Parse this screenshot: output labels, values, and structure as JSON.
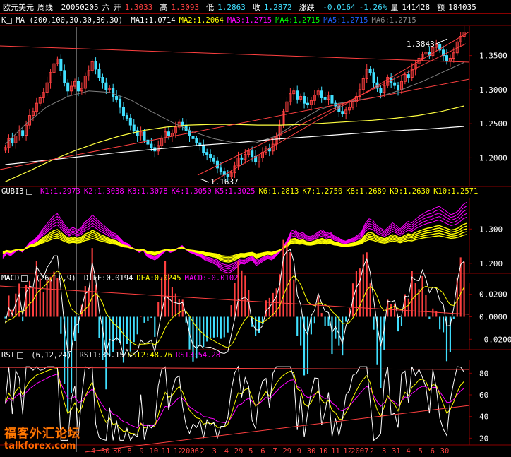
{
  "header": {
    "symbol": "欧元美元",
    "period": "周线",
    "date": "20050205",
    "weekday": "六",
    "open_label": "开",
    "open": "1.3033",
    "high_label": "高",
    "high": "1.3093",
    "low_label": "低",
    "low": "1.2863",
    "close_label": "收",
    "close": "1.2872",
    "change_label": "涨跌",
    "change": "-0.0164",
    "change_pct": "-1.26%",
    "volume_label": "量",
    "volume": "141428",
    "amount_label": "额",
    "amount": "184035"
  },
  "panels": {
    "ma": {
      "label": "K",
      "name": "MA",
      "params": "(200,100,30,30,30,30)",
      "items": [
        {
          "text": "MA1:1.0714",
          "color": "#ffffff"
        },
        {
          "text": "MA2:1.2064",
          "color": "#ffff00"
        },
        {
          "text": "MA3:1.2715",
          "color": "#ff00ff"
        },
        {
          "text": "MA4:1.2715",
          "color": "#00ff00"
        },
        {
          "text": "MA5:1.2715",
          "color": "#2060ff"
        },
        {
          "text": "MA6:1.2715",
          "color": "#888888"
        }
      ]
    },
    "gubi": {
      "name": "GUBI3",
      "items": [
        {
          "text": "K1:1.2973",
          "color": "#ff00ff"
        },
        {
          "text": "K2:1.3038",
          "color": "#ff00ff"
        },
        {
          "text": "K3:1.3078",
          "color": "#ff00ff"
        },
        {
          "text": "K4:1.3050",
          "color": "#ff00ff"
        },
        {
          "text": "K5:1.3025",
          "color": "#ff00ff"
        },
        {
          "text": "K6:1.2813",
          "color": "#ffff00"
        },
        {
          "text": "K7:1.2750",
          "color": "#ffff00"
        },
        {
          "text": "K8:1.2689",
          "color": "#ffff00"
        },
        {
          "text": "K9:1.2630",
          "color": "#ffff00"
        },
        {
          "text": "K10:1.2571",
          "color": "#ffff00"
        }
      ]
    },
    "macd": {
      "name": "MACD",
      "params": "(26,12,9)",
      "items": [
        {
          "text": "DIFF:0.0194",
          "color": "#ffffff"
        },
        {
          "text": "DEA:0.0245",
          "color": "#ffff00"
        },
        {
          "text": "MACD:-0.0102",
          "color": "#ff00ff"
        }
      ]
    },
    "rsi": {
      "name": "RSI",
      "params": "(6,12,24)",
      "items": [
        {
          "text": "RSI1:35.15",
          "color": "#ffffff"
        },
        {
          "text": "RSI2:48.76",
          "color": "#ffff00"
        },
        {
          "text": "RSI3:54.28",
          "color": "#ff00ff"
        }
      ]
    }
  },
  "chart_data": [
    {
      "type": "candlestick",
      "title": "欧元美元 周线",
      "yticks": [
        "1.2000",
        "1.2500",
        "1.3000",
        "1.3500"
      ],
      "ylim": [
        1.16,
        1.39
      ],
      "annotations": [
        "1.3843",
        "1.1637"
      ],
      "close_series": [
        1.215,
        1.228,
        1.222,
        1.232,
        1.24,
        1.233,
        1.248,
        1.262,
        1.268,
        1.28,
        1.288,
        1.296,
        1.31,
        1.325,
        1.338,
        1.345,
        1.328,
        1.31,
        1.298,
        1.305,
        1.312,
        1.298,
        1.302,
        1.32,
        1.328,
        1.341,
        1.33,
        1.318,
        1.31,
        1.3,
        1.302,
        1.29,
        1.286,
        1.274,
        1.262,
        1.258,
        1.248,
        1.24,
        1.232,
        1.238,
        1.226,
        1.22,
        1.215,
        1.21,
        1.218,
        1.229,
        1.238,
        1.232,
        1.236,
        1.245,
        1.252,
        1.248,
        1.24,
        1.232,
        1.228,
        1.222,
        1.218,
        1.208,
        1.205,
        1.2,
        1.195,
        1.185,
        1.18,
        1.175,
        1.172,
        1.178,
        1.188,
        1.2,
        1.198,
        1.205,
        1.21,
        1.202,
        1.194,
        1.2,
        1.208,
        1.214,
        1.21,
        1.22,
        1.232,
        1.248,
        1.268,
        1.282,
        1.294,
        1.298,
        1.286,
        1.29,
        1.28,
        1.278,
        1.284,
        1.292,
        1.298,
        1.288,
        1.286,
        1.292,
        1.28,
        1.276,
        1.268,
        1.265,
        1.27,
        1.274,
        1.282,
        1.29,
        1.3,
        1.316,
        1.33,
        1.325,
        1.31,
        1.302,
        1.296,
        1.306,
        1.318,
        1.31,
        1.306,
        1.3,
        1.312,
        1.322,
        1.318,
        1.33,
        1.338,
        1.346,
        1.352,
        1.355,
        1.35,
        1.362,
        1.366,
        1.358,
        1.35,
        1.342,
        1.346,
        1.354,
        1.37,
        1.378,
        1.3843
      ],
      "ma_white_200": [
        1.12,
        1.126,
        1.132,
        1.138,
        1.145,
        1.152,
        1.16,
        1.168,
        1.176,
        1.183,
        1.19,
        1.196,
        1.202,
        1.208,
        1.213,
        1.218,
        1.222,
        1.227,
        1.231,
        1.235,
        1.239,
        1.242,
        1.246
      ],
      "ma_yellow_100": [
        1.165,
        1.18,
        1.196,
        1.21,
        1.222,
        1.232,
        1.24,
        1.245,
        1.248,
        1.249,
        1.249,
        1.248,
        1.248,
        1.249,
        1.251,
        1.253,
        1.255,
        1.258,
        1.262,
        1.268,
        1.276
      ],
      "ma_gray_30": [
        1.22,
        1.25,
        1.275,
        1.29,
        1.298,
        1.296,
        1.285,
        1.268,
        1.252,
        1.238,
        1.228,
        1.222,
        1.222,
        1.232,
        1.252,
        1.27,
        1.28,
        1.285,
        1.29,
        1.3,
        1.312,
        1.326,
        1.34
      ]
    },
    {
      "type": "line",
      "title": "GUBI3",
      "yticks": [
        "1.200",
        "1.300"
      ],
      "series": [
        {
          "name": "K1-K5",
          "color": "#ff00ff"
        },
        {
          "name": "K6-K10",
          "color": "#ffff00"
        }
      ]
    },
    {
      "type": "bar",
      "title": "MACD",
      "yticks": [
        "0.0200",
        "0.0000",
        "-0.0200"
      ],
      "series": [
        {
          "name": "DIFF",
          "color": "#ffffff"
        },
        {
          "name": "DEA",
          "color": "#ffff00"
        },
        {
          "name": "MACD",
          "color": "#ff00ff"
        }
      ]
    },
    {
      "type": "line",
      "title": "RSI",
      "yticks": [
        "80",
        "60",
        "40",
        "20"
      ],
      "ylim": [
        15,
        90
      ],
      "series": [
        {
          "name": "RSI1",
          "color": "#ffffff"
        },
        {
          "name": "RSI2",
          "color": "#ffff00"
        },
        {
          "name": "RSI3",
          "color": "#ff00ff"
        }
      ]
    }
  ],
  "xaxis": {
    "labels": [
      "4",
      "30",
      "30",
      "8",
      "9",
      "10",
      "11",
      "12",
      "2006",
      "2",
      "3",
      "4",
      "29",
      "5",
      "6",
      "7",
      "29",
      "9",
      "30",
      "10",
      "11",
      "12",
      "2007",
      "2",
      "3",
      "31",
      "4",
      "5",
      "6",
      "30"
    ]
  },
  "watermark": {
    "cn": "福客外汇论坛",
    "en": "talkforex.com"
  },
  "colors": {
    "background": "#000000",
    "up_candle": "#ff4040",
    "down_candle": "#40e0ff",
    "trendline": "#ff4040",
    "axis": "#8b0000"
  }
}
